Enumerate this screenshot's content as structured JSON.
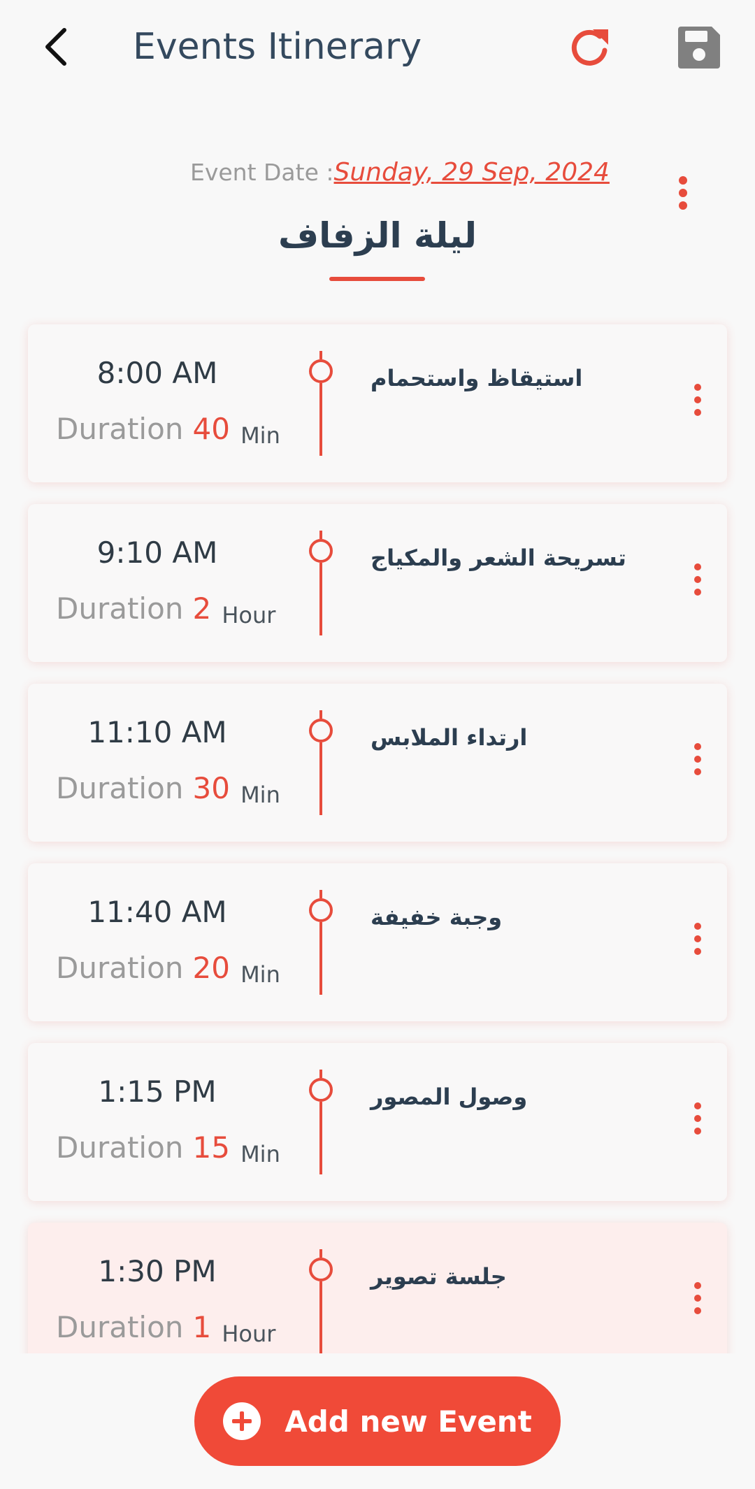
{
  "header": {
    "title": "Events Itinerary",
    "back_icon": "chevron-left-icon",
    "refresh_icon": "refresh-icon",
    "save_icon": "floppy-disk-icon"
  },
  "event": {
    "date_label": "Event Date :",
    "date_value": "Sunday, 29 Sep, 2024",
    "title": "ليلة الزفاف",
    "more_icon": "more-vertical-icon"
  },
  "items": [
    {
      "time": "8:00 AM",
      "duration_label": "Duration",
      "duration_value": "40",
      "duration_unit": "Min",
      "name": "استيقاظ واستحمام"
    },
    {
      "time": "9:10 AM",
      "duration_label": "Duration",
      "duration_value": "2",
      "duration_unit": "Hour",
      "name": "تسريحة الشعر والمكياج"
    },
    {
      "time": "11:10 AM",
      "duration_label": "Duration",
      "duration_value": "30",
      "duration_unit": "Min",
      "name": "ارتداء الملابس"
    },
    {
      "time": "11:40 AM",
      "duration_label": "Duration",
      "duration_value": "20",
      "duration_unit": "Min",
      "name": "وجبة خفيفة"
    },
    {
      "time": "1:15 PM",
      "duration_label": "Duration",
      "duration_value": "15",
      "duration_unit": "Min",
      "name": "وصول المصور"
    },
    {
      "time": "1:30 PM",
      "duration_label": "Duration",
      "duration_value": "1",
      "duration_unit": "Hour",
      "name": "جلسة تصوير"
    }
  ],
  "add_button": {
    "label": "Add new Event",
    "icon": "plus-circle-icon"
  },
  "colors": {
    "accent": "#e74c3c",
    "button": "#f04a38",
    "title": "#34495e",
    "highlight_card": "#fdeeed",
    "save_icon": "#808080"
  }
}
